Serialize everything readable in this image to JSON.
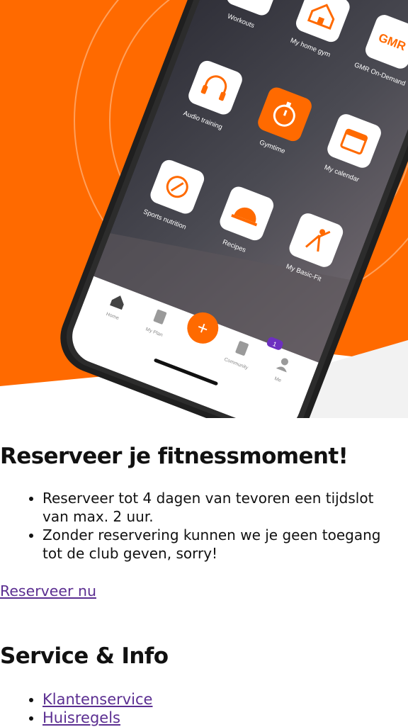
{
  "brand": {
    "accent": "#ff6a00",
    "link": "#5b2e91"
  },
  "phone": {
    "apps": [
      {
        "label": "Workouts",
        "icon": "dumbbell-icon"
      },
      {
        "label": "My home gym",
        "icon": "house-icon"
      },
      {
        "label": "GMR On-Demand",
        "icon": "gmr-logo-icon"
      },
      {
        "label": "Audio training",
        "icon": "headphones-icon"
      },
      {
        "label": "Gymtime",
        "icon": "stopwatch-icon"
      },
      {
        "label": "My calendar",
        "icon": "calendar-icon"
      },
      {
        "label": "Sports nutrition",
        "icon": "nutrition-icon"
      },
      {
        "label": "Recipes",
        "icon": "cloche-icon"
      },
      {
        "label": "My Basic-Fit",
        "icon": "person-stretch-icon"
      }
    ],
    "logo_text": "GMR",
    "tabs": [
      {
        "label": "Home",
        "icon": "home-icon"
      },
      {
        "label": "My Plan",
        "icon": "plan-icon"
      },
      {
        "label": "+",
        "icon": "plus-icon"
      },
      {
        "label": "Community",
        "icon": "community-icon"
      },
      {
        "label": "Me",
        "icon": "user-icon"
      }
    ],
    "badge": "1"
  },
  "reserve": {
    "title": "Reserveer je fitnessmoment!",
    "bullets": [
      "Reserveer tot 4 dagen van tevoren een tijdslot van max. 2 uur.",
      "Zonder reservering kunnen we je geen toegang tot de club geven, sorry!"
    ],
    "cta": "Reserveer nu"
  },
  "service": {
    "title": "Service & Info",
    "links": [
      "Klantenservice",
      "Huisregels"
    ]
  }
}
